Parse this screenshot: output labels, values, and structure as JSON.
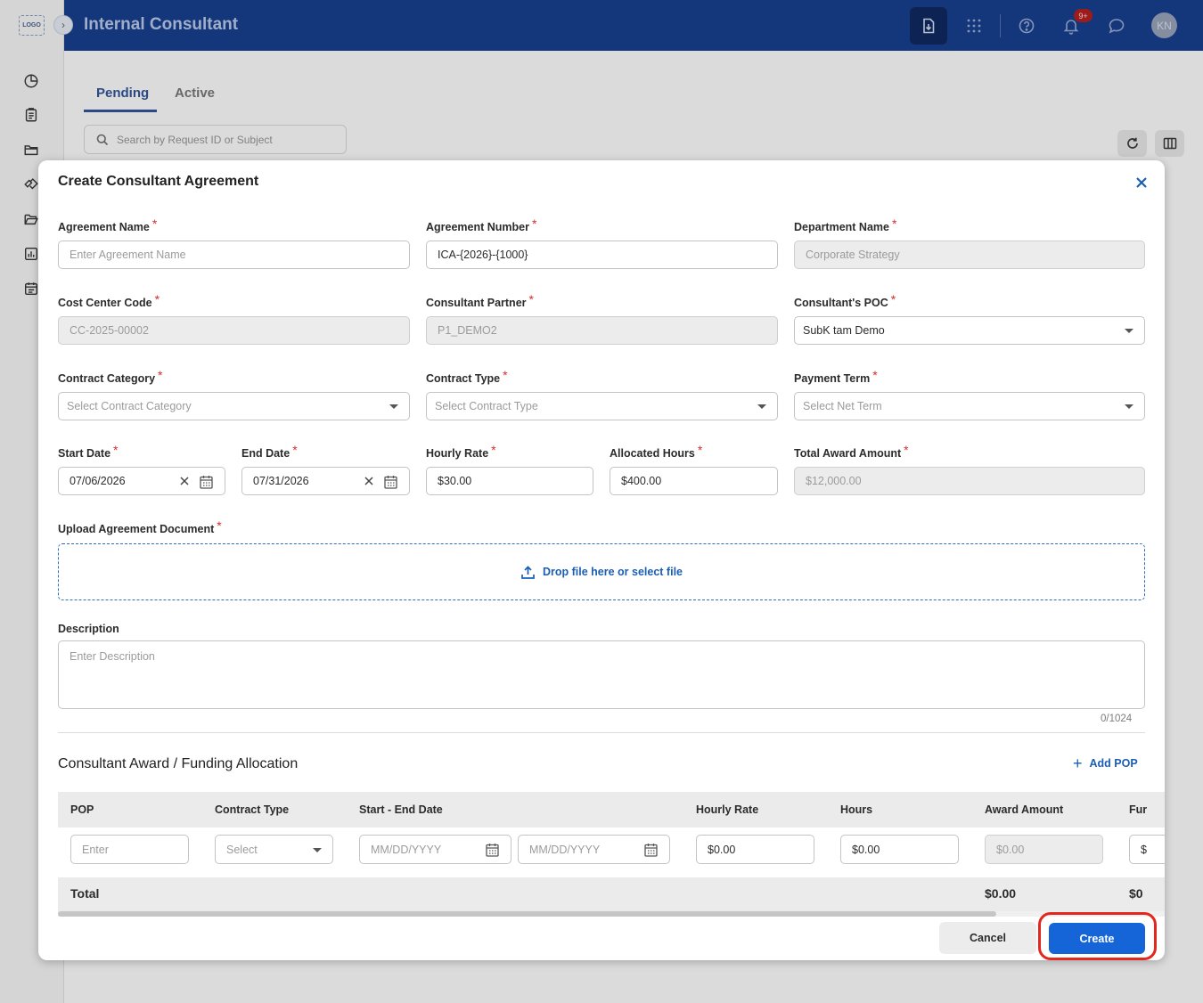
{
  "app": {
    "logo_text": "LOGO",
    "title": "Internal Consultant",
    "notification_badge": "9+",
    "user_initials": "KN"
  },
  "tabs": [
    {
      "label": "Pending",
      "selected": true
    },
    {
      "label": "Active",
      "selected": false
    }
  ],
  "search": {
    "placeholder": "Search by Request ID or Subject"
  },
  "modal": {
    "title": "Create Consultant Agreement",
    "fields": {
      "agreement_name": {
        "label": "Agreement Name",
        "placeholder": "Enter Agreement Name"
      },
      "agreement_number": {
        "label": "Agreement Number",
        "value": "ICA-{2026}-{1000}"
      },
      "department_name": {
        "label": "Department Name",
        "value": "Corporate Strategy"
      },
      "cost_center_code": {
        "label": "Cost Center Code",
        "value": "CC-2025-00002"
      },
      "consultant_partner": {
        "label": "Consultant Partner",
        "value": "P1_DEMO2"
      },
      "consultant_poc": {
        "label": "Consultant's POC",
        "value": "SubK tam Demo"
      },
      "contract_category": {
        "label": "Contract Category",
        "placeholder": "Select Contract Category"
      },
      "contract_type": {
        "label": "Contract Type",
        "placeholder": "Select Contract Type"
      },
      "payment_term": {
        "label": "Payment Term",
        "placeholder": "Select Net Term"
      },
      "start_date": {
        "label": "Start Date",
        "value": "07/06/2026"
      },
      "end_date": {
        "label": "End Date",
        "value": "07/31/2026"
      },
      "hourly_rate": {
        "label": "Hourly Rate",
        "value": "$30.00"
      },
      "allocated_hours": {
        "label": "Allocated Hours",
        "value": "$400.00"
      },
      "total_award_amount": {
        "label": "Total Award Amount",
        "value": "$12,000.00"
      },
      "upload": {
        "label": "Upload Agreement Document",
        "text": "Drop file here or select file"
      },
      "description": {
        "label": "Description",
        "placeholder": "Enter Description",
        "counter": "0/1024"
      }
    },
    "funding": {
      "title": "Consultant Award / Funding Allocation",
      "add_pop_label": "Add POP",
      "columns": [
        "POP",
        "Contract Type",
        "Start - End Date",
        "Hourly Rate",
        "Hours",
        "Award Amount",
        "Fur"
      ],
      "row": {
        "pop_placeholder": "Enter",
        "contract_type_placeholder": "Select",
        "start_placeholder": "MM/DD/YYYY",
        "end_placeholder": "MM/DD/YYYY",
        "hourly_rate": "$0.00",
        "hours": "$0.00",
        "award_amount": "$0.00",
        "fur": "$"
      },
      "total_label": "Total",
      "total_award": "$0.00",
      "total_fur": "$0"
    },
    "buttons": {
      "cancel": "Cancel",
      "create": "Create"
    }
  },
  "colors": {
    "topbar": "#163b83",
    "primary": "#1565d8",
    "required": "#d32f2f",
    "highlight": "#e3261e"
  }
}
